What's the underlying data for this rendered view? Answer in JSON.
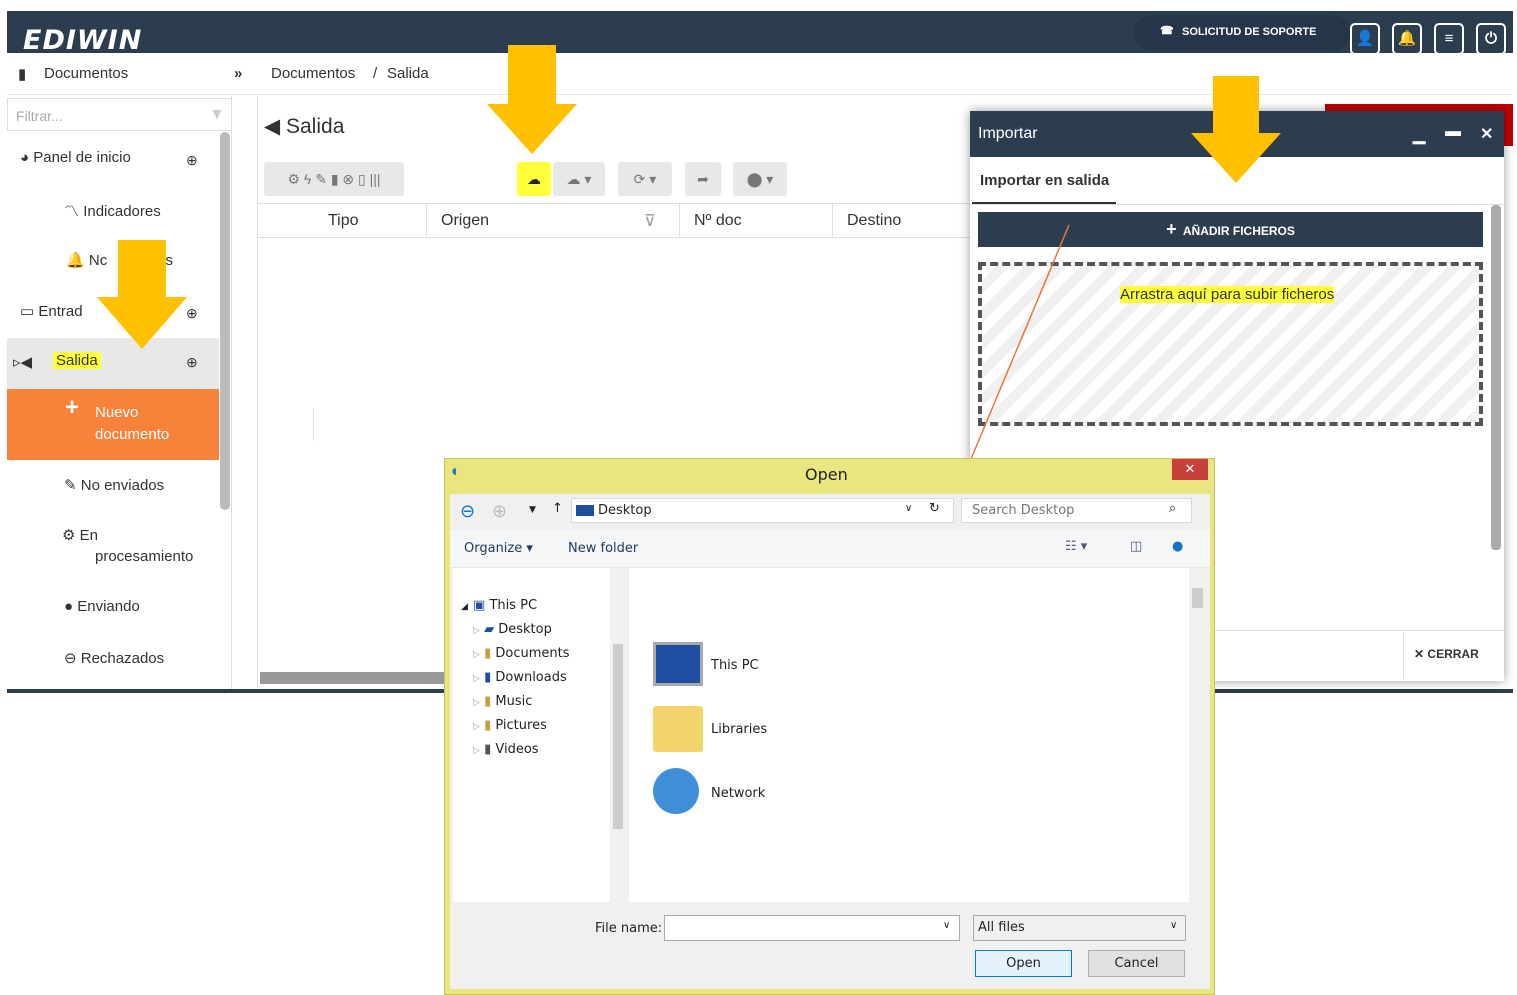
{
  "app": {
    "logo": "EDIWIN",
    "support": "SOLICITUD DE SOPORTE"
  },
  "breadcrumb": {
    "section": "Documentos",
    "path1": "Documentos",
    "sep": "/",
    "path2": "Salida"
  },
  "sidebar": {
    "filter_placeholder": "Filtrar...",
    "items": {
      "panel": "Panel de inicio",
      "indicadores": "Indicadores",
      "notificaciones": "Nc          nes",
      "entrada": "Entrad",
      "salida": "Salida",
      "nuevo1": "Nuevo",
      "nuevo2": "documento",
      "noenviados": "No enviados",
      "enproc1": "En",
      "enproc2": "procesamiento",
      "enviando": "Enviando",
      "rechazados": "Rechazados"
    }
  },
  "main": {
    "title": "Salida",
    "columns": [
      "Tipo",
      "Origen",
      "Nº doc",
      "Destino"
    ]
  },
  "importar": {
    "title": "Importar",
    "tab": "Importar en salida",
    "add_button": "AÑADIR FICHEROS",
    "drop_text": "Arrastra aquí para subir ficheros",
    "close_button": "CERRAR"
  },
  "open_dialog": {
    "title": "Open",
    "address": "Desktop",
    "search_placeholder": "Search Desktop",
    "organize": "Organize ▾",
    "new_folder": "New folder",
    "tree": [
      "This PC",
      "Desktop",
      "Documents",
      "Downloads",
      "Music",
      "Pictures",
      "Videos"
    ],
    "items": [
      "This PC",
      "Libraries",
      "Network"
    ],
    "filename_label": "File name:",
    "filetype": "All files",
    "open_btn": "Open",
    "cancel_btn": "Cancel"
  },
  "colors": {
    "navy": "#2d3d50",
    "orange": "#f7823a",
    "yellow": "#ffc000",
    "highlight": "#ffff3a"
  }
}
